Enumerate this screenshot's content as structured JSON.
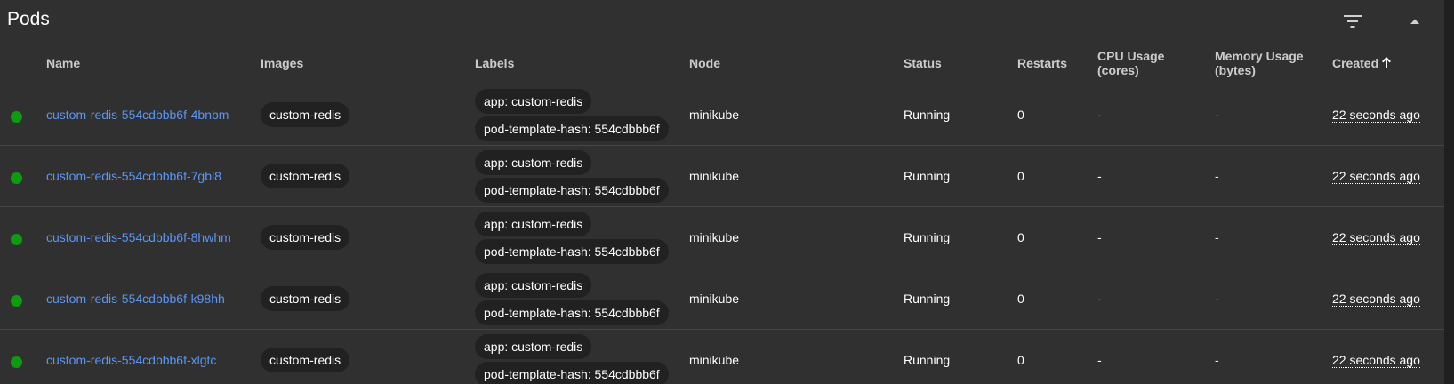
{
  "header": {
    "title": "Pods",
    "filter_icon": "filter-list-icon",
    "collapse_icon": "arrow-drop-up-icon"
  },
  "colors": {
    "background": "#303030",
    "link": "#5a95f5",
    "running": "#0f9b0f",
    "chip": "#212121"
  },
  "columns": {
    "name": "Name",
    "images": "Images",
    "labels": "Labels",
    "node": "Node",
    "status": "Status",
    "restarts": "Restarts",
    "cpu": "CPU Usage (cores)",
    "memory": "Memory Usage (bytes)",
    "created": "Created",
    "created_sort_icon": "arrow-upward-icon"
  },
  "rows": [
    {
      "name": "custom-redis-554cdbbb6f-4bnbm",
      "image": "custom-redis",
      "labels": [
        "app: custom-redis",
        "pod-template-hash: 554cdbbb6f"
      ],
      "node": "minikube",
      "status": "Running",
      "restarts": "0",
      "cpu": "-",
      "memory": "-",
      "created": "22 seconds ago"
    },
    {
      "name": "custom-redis-554cdbbb6f-7gbl8",
      "image": "custom-redis",
      "labels": [
        "app: custom-redis",
        "pod-template-hash: 554cdbbb6f"
      ],
      "node": "minikube",
      "status": "Running",
      "restarts": "0",
      "cpu": "-",
      "memory": "-",
      "created": "22 seconds ago"
    },
    {
      "name": "custom-redis-554cdbbb6f-8hwhm",
      "image": "custom-redis",
      "labels": [
        "app: custom-redis",
        "pod-template-hash: 554cdbbb6f"
      ],
      "node": "minikube",
      "status": "Running",
      "restarts": "0",
      "cpu": "-",
      "memory": "-",
      "created": "22 seconds ago"
    },
    {
      "name": "custom-redis-554cdbbb6f-k98hh",
      "image": "custom-redis",
      "labels": [
        "app: custom-redis",
        "pod-template-hash: 554cdbbb6f"
      ],
      "node": "minikube",
      "status": "Running",
      "restarts": "0",
      "cpu": "-",
      "memory": "-",
      "created": "22 seconds ago"
    },
    {
      "name": "custom-redis-554cdbbb6f-xlgtc",
      "image": "custom-redis",
      "labels": [
        "app: custom-redis",
        "pod-template-hash: 554cdbbb6f"
      ],
      "node": "minikube",
      "status": "Running",
      "restarts": "0",
      "cpu": "-",
      "memory": "-",
      "created": "22 seconds ago"
    }
  ]
}
